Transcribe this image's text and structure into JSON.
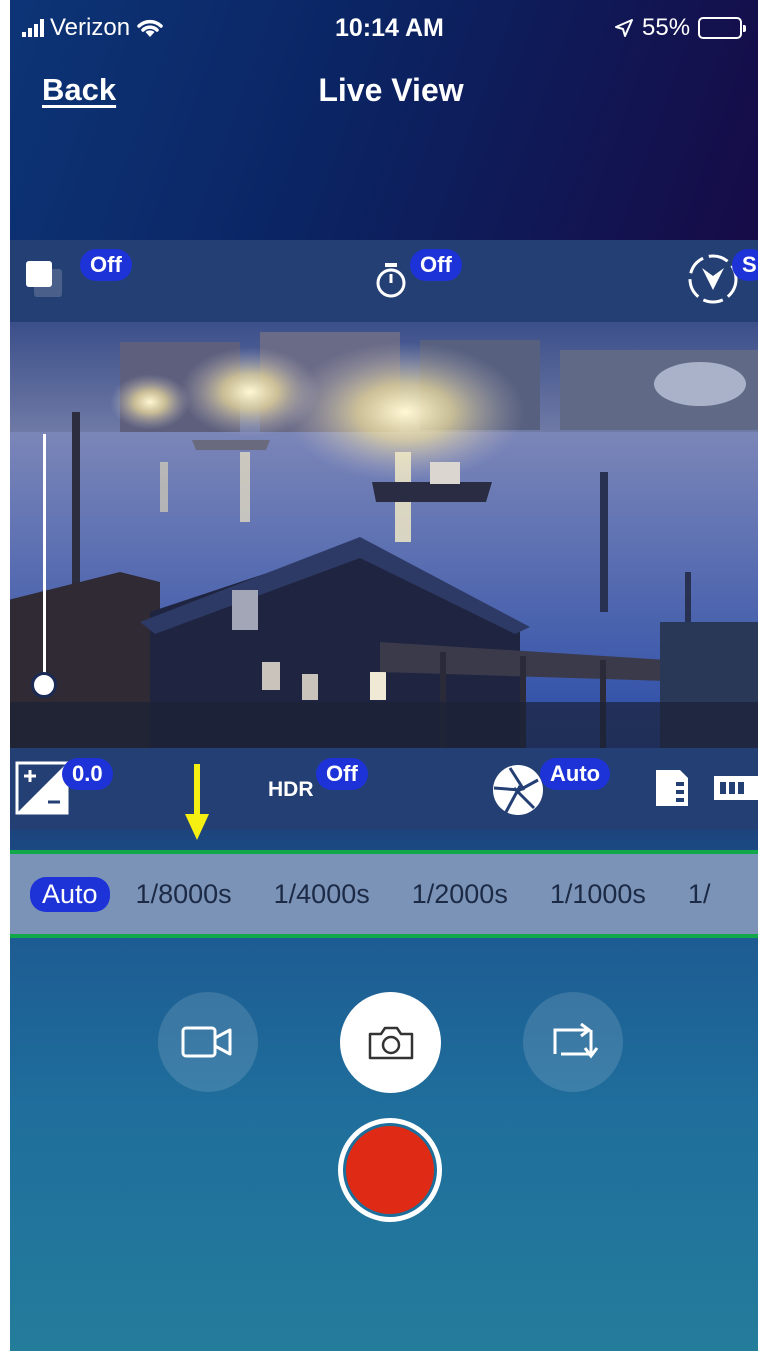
{
  "status_bar": {
    "carrier": "Verizon",
    "time": "10:14 AM",
    "battery": "55%"
  },
  "nav": {
    "back_label": "Back",
    "title": "Live View"
  },
  "top_settings": {
    "drive_mode": "Off",
    "self_timer": "Off",
    "shooting_mode": "S"
  },
  "bottom_settings": {
    "exposure_compensation": "0.0",
    "hdr_label": "HDR",
    "hdr_value": "Off",
    "aperture": "Auto"
  },
  "shutter_speed": {
    "selected": "Auto",
    "options": [
      "Auto",
      "1/8000s",
      "1/4000s",
      "1/2000s",
      "1/1000s",
      "1/"
    ]
  },
  "zoom_level": 0.0,
  "colors": {
    "accent_pill": "#1d33d8",
    "highlight_box": "#11a84a",
    "annotation_arrow": "#f5f012",
    "record_button": "#df2b15"
  },
  "icons": [
    "signal-bars-icon",
    "wifi-icon",
    "location-arrow-icon",
    "battery-icon",
    "drive-mode-icon",
    "self-timer-icon",
    "shooting-mode-icon",
    "exposure-compensation-icon",
    "aperture-icon",
    "sd-card-icon",
    "camera-battery-icon",
    "video-camera-icon",
    "camera-icon",
    "switch-camera-icon"
  ]
}
